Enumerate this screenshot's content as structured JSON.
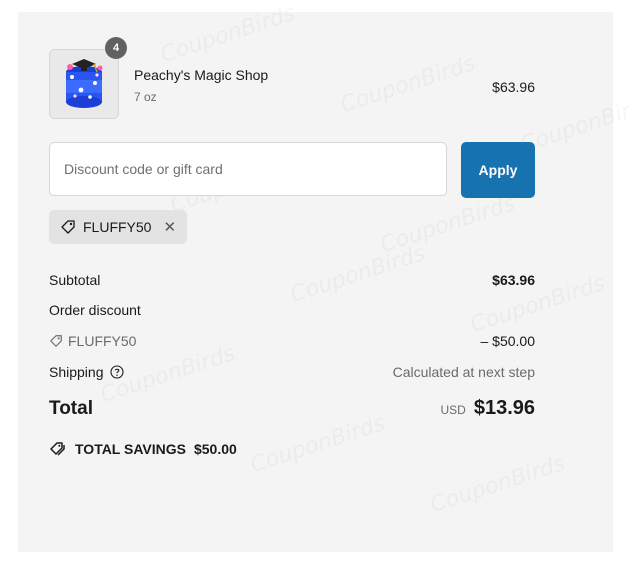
{
  "watermark": "CouponBirds",
  "product": {
    "name": "Peachy's Magic Shop",
    "variant": "7 oz",
    "price": "$63.96",
    "quantity": "4",
    "thumbnail_icon": "slime-jar-icon"
  },
  "discount": {
    "placeholder": "Discount code or gift card",
    "value": "",
    "apply_label": "Apply",
    "applied_code": "FLUFFY50"
  },
  "summary": {
    "subtotal_label": "Subtotal",
    "subtotal_value": "$63.96",
    "order_discount_label": "Order discount",
    "discount_code": "FLUFFY50",
    "discount_value": "– $50.00",
    "shipping_label": "Shipping",
    "shipping_value": "Calculated at next step",
    "total_label": "Total",
    "currency": "USD",
    "total_value": "$13.96",
    "savings_label": "TOTAL SAVINGS",
    "savings_value": "$50.00"
  },
  "colors": {
    "panel_bg": "#f4f4f4",
    "apply_button": "#1773b0",
    "chip_bg": "#e3e3e3",
    "badge_bg": "#616161"
  }
}
